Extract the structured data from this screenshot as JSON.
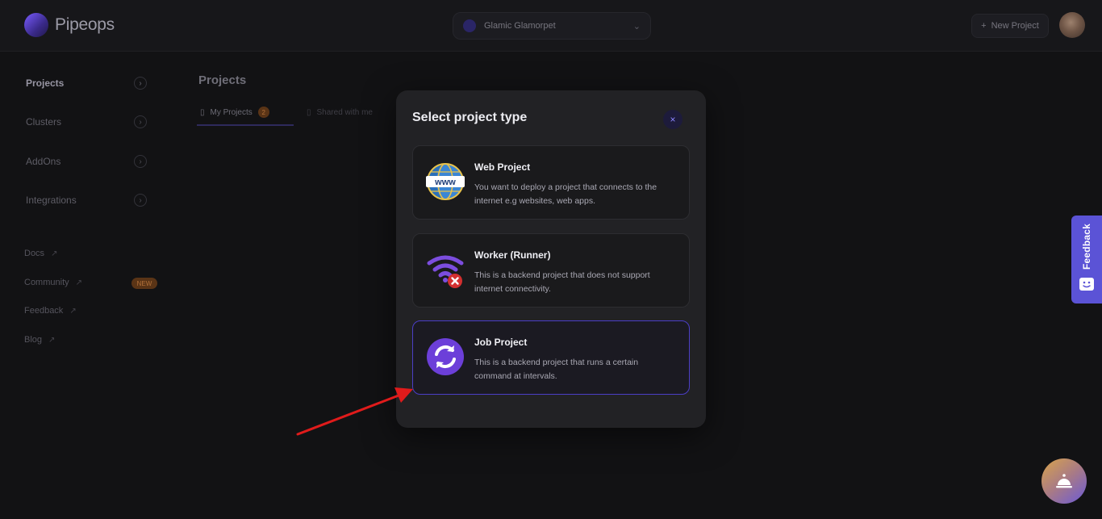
{
  "topbar": {
    "logo_text": "Pipeops",
    "workspace_name": "Glamic Glamorpet",
    "new_project_label": "New Project"
  },
  "sidebar": {
    "items": [
      {
        "label": "Projects",
        "active": true
      },
      {
        "label": "Clusters"
      },
      {
        "label": "AddOns"
      },
      {
        "label": "Integrations"
      }
    ],
    "links": [
      {
        "label": "Docs"
      },
      {
        "label": "Community",
        "badge": "NEW"
      },
      {
        "label": "Feedback"
      },
      {
        "label": "Blog"
      }
    ]
  },
  "main": {
    "title": "Projects",
    "tabs": [
      {
        "label": "My Projects",
        "count": "2"
      },
      {
        "label": "Shared with me"
      }
    ]
  },
  "modal": {
    "title": "Select project type",
    "close_icon": "×",
    "options": [
      {
        "title": "Web Project",
        "description": "You want to deploy a project that connects to the internet e.g websites, web apps.",
        "icon": "globe-www-icon"
      },
      {
        "title": "Worker (Runner)",
        "description": "This is a backend project that does not support internet connectivity.",
        "icon": "wifi-off-icon"
      },
      {
        "title": "Job Project",
        "description": "This is a backend project that runs a certain command at intervals.",
        "icon": "sync-icon",
        "selected": true
      }
    ]
  },
  "feedback": {
    "label": "Feedback"
  },
  "colors": {
    "accent": "#5b53d6",
    "selected_border": "#4b3ec6",
    "annotation_arrow": "#e01b1b"
  }
}
